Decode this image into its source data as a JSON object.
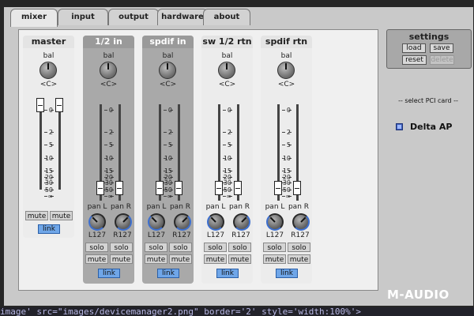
{
  "editor_line": "image' src=\"images/devicemanager2.png\" border='2' style='width:100%'>",
  "tabs": [
    {
      "label": "mixer",
      "active": true
    },
    {
      "label": "input",
      "active": false
    },
    {
      "label": "output",
      "active": false
    },
    {
      "label": "hardware",
      "active": false
    },
    {
      "label": "about",
      "active": false
    }
  ],
  "strips": [
    {
      "title": "master",
      "bal_label": "bal",
      "bal_value": "<C>",
      "mute_l": "mute",
      "mute_r": "mute",
      "link": "link"
    },
    {
      "title": "1/2 in",
      "bal_label": "bal",
      "bal_value": "<C>",
      "pan_l": "pan L",
      "pan_r": "pan R",
      "pan_l_value": "L127",
      "pan_r_value": "R127",
      "solo_l": "solo",
      "solo_r": "solo",
      "mute_l": "mute",
      "mute_r": "mute",
      "link": "link"
    },
    {
      "title": "spdif in",
      "bal_label": "bal",
      "bal_value": "<C>",
      "pan_l": "pan L",
      "pan_r": "pan R",
      "pan_l_value": "L127",
      "pan_r_value": "R127",
      "solo_l": "solo",
      "solo_r": "solo",
      "mute_l": "mute",
      "mute_r": "mute",
      "link": "link"
    },
    {
      "title": "sw 1/2 rtn",
      "bal_label": "bal",
      "bal_value": "<C>",
      "pan_l": "pan L",
      "pan_r": "pan R",
      "pan_l_value": "L127",
      "pan_r_value": "R127",
      "solo_l": "solo",
      "solo_r": "solo",
      "mute_l": "mute",
      "mute_r": "mute",
      "link": "link"
    },
    {
      "title": "spdif rtn",
      "bal_label": "bal",
      "bal_value": "<C>",
      "pan_l": "pan L",
      "pan_r": "pan R",
      "pan_l_value": "L127",
      "pan_r_value": "R127",
      "solo_l": "solo",
      "solo_r": "solo",
      "mute_l": "mute",
      "mute_r": "mute",
      "link": "link"
    }
  ],
  "fader_scale": [
    "0",
    "2",
    "5",
    "10",
    "15",
    "20",
    "30",
    "50",
    "∞"
  ],
  "settings": {
    "title": "settings",
    "load": "load",
    "save": "save",
    "reset": "reset",
    "delete": "delete"
  },
  "pci": {
    "label": "-- select PCI card --",
    "card": "Delta AP"
  },
  "brand": "M-AUDIO",
  "colors": {
    "link_button": "#6fa6e8",
    "active_knob_arc": "#3d6fcf",
    "window_bg": "#c9c9c9"
  }
}
